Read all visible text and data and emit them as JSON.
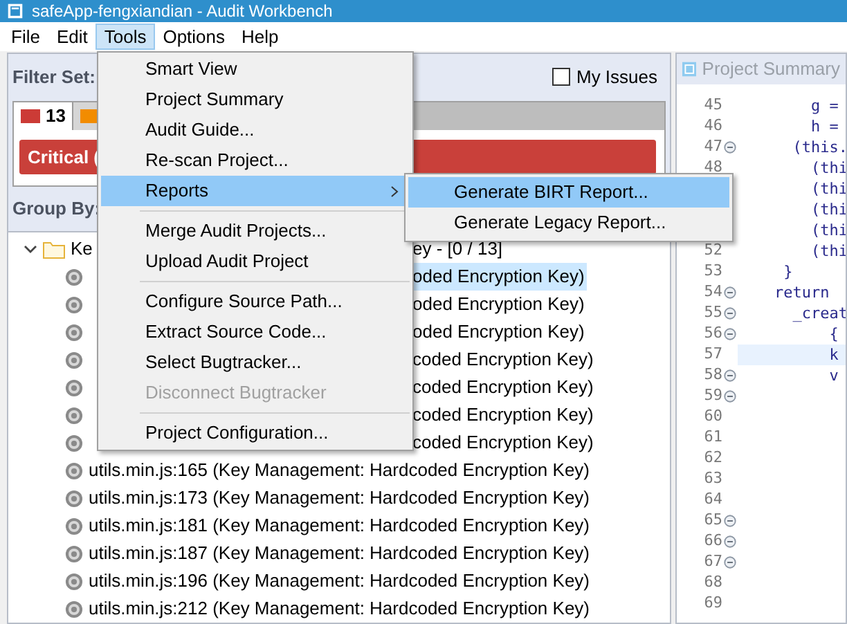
{
  "window": {
    "title": "safeApp-fengxiandian - Audit Workbench"
  },
  "menubar": [
    {
      "label": "File",
      "selected": false
    },
    {
      "label": "Edit",
      "selected": false
    },
    {
      "label": "Tools",
      "selected": true
    },
    {
      "label": "Options",
      "selected": false
    },
    {
      "label": "Help",
      "selected": false
    }
  ],
  "issues_panel": {
    "filter_label": "Filter Set:",
    "my_issues": {
      "label": "My Issues",
      "checked": false
    },
    "tabs": [
      {
        "label": "13",
        "color": "#cc3b36",
        "selected": true
      },
      {
        "color": "#f28c00",
        "selected": false
      }
    ],
    "severity_bar": {
      "label": "Critical ("
    },
    "group_by_label": "Group By:",
    "tree": {
      "folder": {
        "visible_start": "Ke",
        "visible_end": "ey - [0 / 13]",
        "expanded": true
      },
      "rows": [
        {
          "kind": "occluded",
          "visible_end": "oded Encryption Key)",
          "selected": true
        },
        {
          "kind": "occluded",
          "visible_end": "oded Encryption Key)",
          "selected": false
        },
        {
          "kind": "occluded",
          "visible_end": "oded Encryption Key)",
          "selected": false
        },
        {
          "kind": "occluded",
          "visible_end": "coded Encryption Key)",
          "selected": false
        },
        {
          "kind": "occluded",
          "visible_end": "coded Encryption Key)",
          "selected": false
        },
        {
          "kind": "occluded",
          "visible_end": "coded Encryption Key)",
          "selected": false
        },
        {
          "kind": "occluded",
          "visible_end": "coded Encryption Key)",
          "selected": false
        },
        {
          "kind": "full",
          "text": "utils.min.js:165 (Key Management: Hardcoded Encryption Key)",
          "selected": false
        },
        {
          "kind": "full",
          "text": "utils.min.js:173 (Key Management: Hardcoded Encryption Key)",
          "selected": false
        },
        {
          "kind": "full",
          "text": "utils.min.js:181 (Key Management: Hardcoded Encryption Key)",
          "selected": false
        },
        {
          "kind": "full",
          "text": "utils.min.js:187 (Key Management: Hardcoded Encryption Key)",
          "selected": false
        },
        {
          "kind": "full",
          "text": "utils.min.js:196 (Key Management: Hardcoded Encryption Key)",
          "selected": false
        },
        {
          "kind": "full",
          "text": "utils.min.js:212 (Key Management: Hardcoded Encryption Key)",
          "selected": false
        }
      ]
    }
  },
  "editor": {
    "tab": {
      "label": "Project Summary"
    },
    "lines": [
      {
        "number": "45",
        "code": "        g =",
        "fold": false,
        "current": false
      },
      {
        "number": "46",
        "code": "        h =",
        "fold": false,
        "current": false
      },
      {
        "number": "47",
        "code": "      (this.",
        "fold": true,
        "current": false
      },
      {
        "number": "48",
        "code": "        (thi",
        "fold": false,
        "current": false
      },
      {
        "code": "        (thi",
        "fold": false,
        "current": false
      },
      {
        "code": "        (thi",
        "fold": false,
        "current": false
      },
      {
        "code": "        (thi",
        "fold": false,
        "current": false
      },
      {
        "number": "52",
        "code": "        (thi",
        "fold": false,
        "current": false
      },
      {
        "number": "53",
        "code": "     }",
        "fold": false,
        "current": false
      },
      {
        "number": "54",
        "code": "    return",
        "fold": true,
        "current": false
      },
      {
        "number": "55",
        "code": "      _creat",
        "fold": true,
        "current": false
      },
      {
        "number": "56",
        "code": "          {",
        "fold": true,
        "current": false
      },
      {
        "number": "57",
        "code": "          k",
        "fold": false,
        "current": true
      },
      {
        "number": "58",
        "code": "          v",
        "fold": true,
        "current": false
      },
      {
        "number": "59",
        "fold": true,
        "current": false
      },
      {
        "number": "60",
        "fold": false,
        "current": false
      },
      {
        "number": "61",
        "fold": false,
        "current": false
      },
      {
        "number": "62",
        "fold": false,
        "current": false
      },
      {
        "number": "63",
        "fold": false,
        "current": false
      },
      {
        "number": "64",
        "fold": false,
        "current": false
      },
      {
        "number": "65",
        "fold": true,
        "current": false
      },
      {
        "number": "66",
        "fold": true,
        "current": false
      },
      {
        "number": "67",
        "fold": true,
        "current": false
      },
      {
        "number": "68",
        "fold": false,
        "current": false
      },
      {
        "number": "69",
        "fold": false,
        "current": false
      }
    ]
  },
  "tools_menu": {
    "groups": [
      [
        {
          "label": "Smart View",
          "selected": false,
          "disabled": false,
          "submenu": false
        },
        {
          "label": "Project Summary",
          "selected": false,
          "disabled": false,
          "submenu": false
        },
        {
          "label": "Audit Guide...",
          "selected": false,
          "disabled": false,
          "submenu": false
        },
        {
          "label": "Re-scan Project...",
          "selected": false,
          "disabled": false,
          "submenu": false
        },
        {
          "label": "Reports",
          "selected": true,
          "disabled": false,
          "submenu": true
        }
      ],
      [
        {
          "label": "Merge Audit Projects...",
          "selected": false,
          "disabled": false,
          "submenu": false
        },
        {
          "label": "Upload Audit Project",
          "selected": false,
          "disabled": false,
          "submenu": false
        }
      ],
      [
        {
          "label": "Configure Source Path...",
          "selected": false,
          "disabled": false,
          "submenu": false
        },
        {
          "label": "Extract Source Code...",
          "selected": false,
          "disabled": false,
          "submenu": false
        },
        {
          "label": "Select Bugtracker...",
          "selected": false,
          "disabled": false,
          "submenu": false
        },
        {
          "label": "Disconnect Bugtracker",
          "selected": false,
          "disabled": true,
          "submenu": false
        }
      ],
      [
        {
          "label": "Project Configuration...",
          "selected": false,
          "disabled": false,
          "submenu": false
        }
      ]
    ]
  },
  "reports_submenu": [
    {
      "label": "Generate BIRT Report...",
      "selected": true
    },
    {
      "label": "Generate Legacy Report...",
      "selected": false
    }
  ]
}
